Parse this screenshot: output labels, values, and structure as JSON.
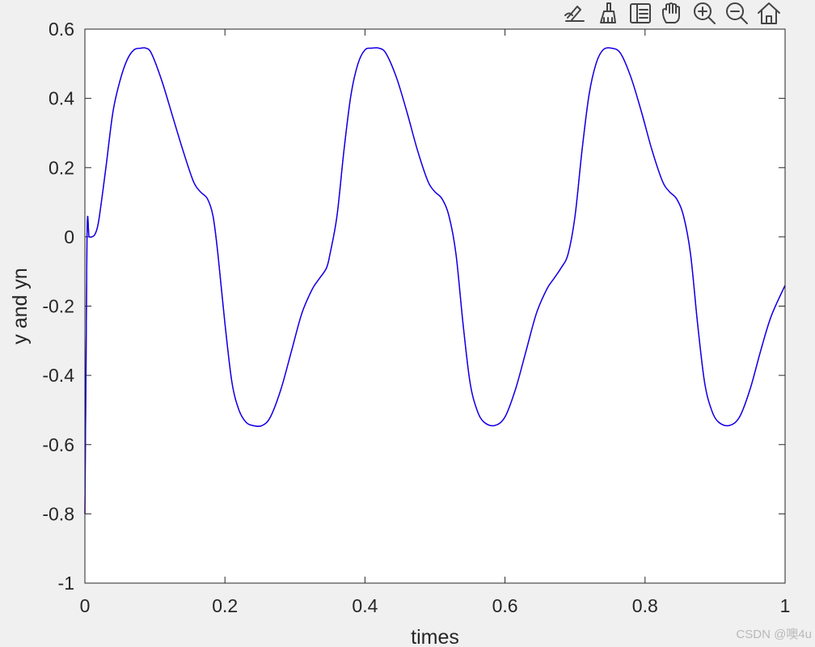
{
  "toolbar": {
    "icons": [
      "edit-plot-icon",
      "brush-icon",
      "legend-icon",
      "pan-hand-icon",
      "zoom-in-icon",
      "zoom-out-icon",
      "home-icon"
    ]
  },
  "watermark": "CSDN @噢4u",
  "colors": {
    "figure_bg": "#f0f0f0",
    "axes_bg": "#ffffff",
    "axis": "#262626",
    "series_y": "#ff0000",
    "series_yn": "#0000ff"
  },
  "chart_data": {
    "type": "line",
    "title": "",
    "xlabel": "times",
    "ylabel": "y and yn",
    "xlim": [
      0,
      1
    ],
    "ylim": [
      -1,
      0.6
    ],
    "xticks": [
      0,
      0.2,
      0.4,
      0.6,
      0.8,
      1
    ],
    "xtick_labels": [
      "0",
      "0.2",
      "0.4",
      "0.6",
      "0.8",
      "1"
    ],
    "yticks": [
      -1,
      -0.8,
      -0.6,
      -0.4,
      -0.2,
      0,
      0.2,
      0.4,
      0.6
    ],
    "ytick_labels": [
      "-1",
      "-0.8",
      "-0.6",
      "-0.4",
      "-0.2",
      "0",
      "0.2",
      "0.4",
      "0.6"
    ],
    "grid": false,
    "legend": "none",
    "series": [
      {
        "color": "#ff0000",
        "x": [
          0,
          0.003,
          0.006,
          0.01,
          0.015,
          0.02,
          0.03,
          0.04,
          0.05,
          0.06,
          0.07,
          0.08,
          0.087,
          0.095,
          0.11,
          0.125,
          0.14,
          0.155,
          0.165,
          0.175,
          0.183,
          0.19,
          0.2,
          0.21,
          0.22,
          0.23,
          0.24,
          0.253,
          0.265,
          0.28,
          0.295,
          0.31,
          0.325,
          0.335,
          0.345,
          0.35,
          0.36,
          0.37,
          0.38,
          0.39,
          0.4,
          0.41,
          0.42,
          0.43,
          0.445,
          0.46,
          0.475,
          0.49,
          0.5,
          0.51,
          0.52,
          0.53,
          0.54,
          0.55,
          0.56,
          0.57,
          0.585,
          0.6,
          0.615,
          0.63,
          0.645,
          0.66,
          0.67,
          0.68,
          0.69,
          0.7,
          0.71,
          0.72,
          0.73,
          0.74,
          0.752,
          0.765,
          0.78,
          0.795,
          0.81,
          0.825,
          0.835,
          0.845,
          0.855,
          0.865,
          0.875,
          0.885,
          0.895,
          0.905,
          0.92,
          0.935,
          0.95,
          0.965,
          0.98,
          1.0
        ],
        "y": [
          -0.8,
          0.0,
          0.0,
          0.0,
          0.01,
          0.05,
          0.2,
          0.36,
          0.45,
          0.51,
          0.54,
          0.545,
          0.545,
          0.53,
          0.45,
          0.35,
          0.25,
          0.16,
          0.13,
          0.11,
          0.06,
          -0.05,
          -0.25,
          -0.42,
          -0.5,
          -0.535,
          -0.545,
          -0.545,
          -0.52,
          -0.44,
          -0.33,
          -0.22,
          -0.15,
          -0.12,
          -0.09,
          -0.05,
          0.06,
          0.25,
          0.41,
          0.5,
          0.54,
          0.545,
          0.545,
          0.53,
          0.46,
          0.36,
          0.25,
          0.16,
          0.13,
          0.11,
          0.06,
          -0.05,
          -0.25,
          -0.42,
          -0.5,
          -0.535,
          -0.545,
          -0.52,
          -0.44,
          -0.33,
          -0.22,
          -0.15,
          -0.12,
          -0.09,
          -0.05,
          0.06,
          0.25,
          0.41,
          0.5,
          0.54,
          0.545,
          0.53,
          0.46,
          0.36,
          0.25,
          0.16,
          0.13,
          0.11,
          0.06,
          -0.05,
          -0.25,
          -0.42,
          -0.5,
          -0.535,
          -0.545,
          -0.52,
          -0.44,
          -0.33,
          -0.23,
          -0.14
        ]
      },
      {
        "color": "#0000ff",
        "x": [
          0,
          0.003,
          0.006,
          0.01,
          0.015,
          0.02,
          0.03,
          0.04,
          0.05,
          0.06,
          0.07,
          0.08,
          0.087,
          0.095,
          0.11,
          0.125,
          0.14,
          0.155,
          0.165,
          0.175,
          0.183,
          0.19,
          0.2,
          0.21,
          0.22,
          0.23,
          0.24,
          0.253,
          0.265,
          0.28,
          0.295,
          0.31,
          0.325,
          0.335,
          0.345,
          0.35,
          0.36,
          0.37,
          0.38,
          0.39,
          0.4,
          0.41,
          0.42,
          0.43,
          0.445,
          0.46,
          0.475,
          0.49,
          0.5,
          0.51,
          0.52,
          0.53,
          0.54,
          0.55,
          0.56,
          0.57,
          0.585,
          0.6,
          0.615,
          0.63,
          0.645,
          0.66,
          0.67,
          0.68,
          0.69,
          0.7,
          0.71,
          0.72,
          0.73,
          0.74,
          0.752,
          0.765,
          0.78,
          0.795,
          0.81,
          0.825,
          0.835,
          0.845,
          0.855,
          0.865,
          0.875,
          0.885,
          0.895,
          0.905,
          0.92,
          0.935,
          0.95,
          0.965,
          0.98,
          1.0
        ],
        "y": [
          -0.8,
          0.0,
          0.0,
          0.0,
          0.01,
          0.05,
          0.2,
          0.36,
          0.45,
          0.51,
          0.54,
          0.545,
          0.545,
          0.53,
          0.45,
          0.35,
          0.25,
          0.16,
          0.13,
          0.11,
          0.06,
          -0.05,
          -0.25,
          -0.42,
          -0.5,
          -0.535,
          -0.545,
          -0.545,
          -0.52,
          -0.44,
          -0.33,
          -0.22,
          -0.15,
          -0.12,
          -0.09,
          -0.05,
          0.06,
          0.25,
          0.41,
          0.5,
          0.54,
          0.545,
          0.545,
          0.53,
          0.46,
          0.36,
          0.25,
          0.16,
          0.13,
          0.11,
          0.06,
          -0.05,
          -0.25,
          -0.42,
          -0.5,
          -0.535,
          -0.545,
          -0.52,
          -0.44,
          -0.33,
          -0.22,
          -0.15,
          -0.12,
          -0.09,
          -0.05,
          0.06,
          0.25,
          0.41,
          0.5,
          0.54,
          0.545,
          0.53,
          0.46,
          0.36,
          0.25,
          0.16,
          0.13,
          0.11,
          0.06,
          -0.05,
          -0.25,
          -0.42,
          -0.5,
          -0.535,
          -0.545,
          -0.52,
          -0.44,
          -0.33,
          -0.23,
          -0.14
        ]
      }
    ]
  }
}
